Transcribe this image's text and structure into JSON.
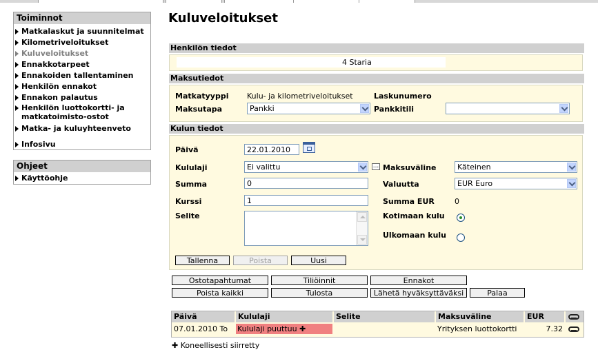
{
  "sidebar": {
    "toiminnot_title": "Toiminnot",
    "items": [
      {
        "label": "Matkalaskut ja suunnitelmat"
      },
      {
        "label": "Kilometriveloitukset"
      },
      {
        "label": "Kuluveloitukset"
      },
      {
        "label": "Ennakkotarpeet"
      },
      {
        "label": "Ennakoiden tallentaminen"
      },
      {
        "label": "Henkilön ennakot"
      },
      {
        "label": "Ennakon palautus"
      },
      {
        "label": "Henkilön luottokortti- ja matkatoimisto-ostot"
      },
      {
        "label": "Matka- ja kuluyhteenveto"
      },
      {
        "label": "Infosivu"
      }
    ],
    "ohjeet_title": "Ohjeet",
    "help_items": [
      {
        "label": "Käyttöohje"
      }
    ]
  },
  "page": {
    "title": "Kuluveloitukset"
  },
  "henkilo": {
    "header": "Henkilön tiedot",
    "person": "4 Staria"
  },
  "maksu": {
    "header": "Maksutiedot",
    "matkatyyppi_label": "Matkatyyppi",
    "matkatyyppi_value": "Kulu- ja kilometriveloitukset",
    "laskunumero_label": "Laskunumero",
    "maksutapa_label": "Maksutapa",
    "maksutapa_value": "Pankki",
    "pankkitili_label": "Pankkitili",
    "pankkitili_value": ""
  },
  "kulu": {
    "header": "Kulun tiedot",
    "paiva_label": "Päivä",
    "paiva_value": "22.01.2010",
    "kululaji_label": "Kululaji",
    "kululaji_value": "Ei valittu",
    "dots": "...",
    "maksuvaline_label": "Maksuväline",
    "maksuvaline_value": "Käteinen",
    "summa_label": "Summa",
    "summa_value": "0",
    "valuutta_label": "Valuutta",
    "valuutta_value": "EUR Euro",
    "kurssi_label": "Kurssi",
    "kurssi_value": "1",
    "summa_eur_label": "Summa EUR",
    "summa_eur_value": "0",
    "selite_label": "Selite",
    "kotimaan_label": "Kotimaan kulu",
    "ulkomaan_label": "Ulkomaan kulu",
    "tallenna": "Tallenna",
    "poista": "Poista",
    "uusi": "Uusi"
  },
  "actions": {
    "ostotapahtumat": "Ostotapahtumat",
    "tiliointi": "Tiliöinnit",
    "ennakot": "Ennakot",
    "poista_kaikki": "Poista kaikki",
    "tulosta": "Tulosta",
    "laheta": "Lähetä hyväksyttäväksi",
    "palaa": "Palaa"
  },
  "table": {
    "headers": [
      "Päivä",
      "Kululaji",
      "Selite",
      "Maksuväline",
      "EUR"
    ],
    "rows": [
      {
        "paiva": "07.01.2010 To",
        "kululaji": "Kululaji puuttuu",
        "selite": "",
        "maksuvaline": "Yrityksen luottokortti",
        "eur": "7.32"
      }
    ],
    "error_color": "#f08080"
  },
  "footer": {
    "note": "Koneellisesti siirretty"
  }
}
